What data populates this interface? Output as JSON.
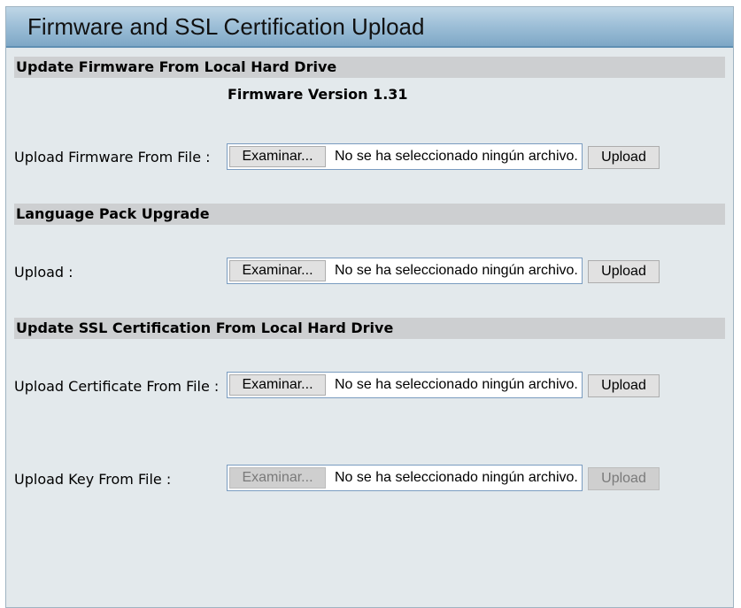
{
  "window": {
    "title": "Firmware and SSL Certification Upload"
  },
  "firmware": {
    "header": "Update Firmware From Local Hard Drive",
    "version_label": "Firmware Version 1.31",
    "row": {
      "label": "Upload Firmware From File :",
      "browse_label": "Examinar...",
      "file_status": "No se ha seleccionado ningún archivo.",
      "upload_label": "Upload"
    }
  },
  "language": {
    "header": "Language Pack Upgrade",
    "row": {
      "label": "Upload :",
      "browse_label": "Examinar...",
      "file_status": "No se ha seleccionado ningún archivo.",
      "upload_label": "Upload"
    }
  },
  "ssl": {
    "header": "Update SSL Certification From Local Hard Drive",
    "certificate_row": {
      "label": "Upload Certificate From File :",
      "browse_label": "Examinar...",
      "file_status": "No se ha seleccionado ningún archivo.",
      "upload_label": "Upload"
    },
    "key_row": {
      "label": "Upload Key From File :",
      "browse_label": "Examinar...",
      "file_status": "No se ha seleccionado ningún archivo.",
      "upload_label": "Upload",
      "disabled": true
    }
  }
}
